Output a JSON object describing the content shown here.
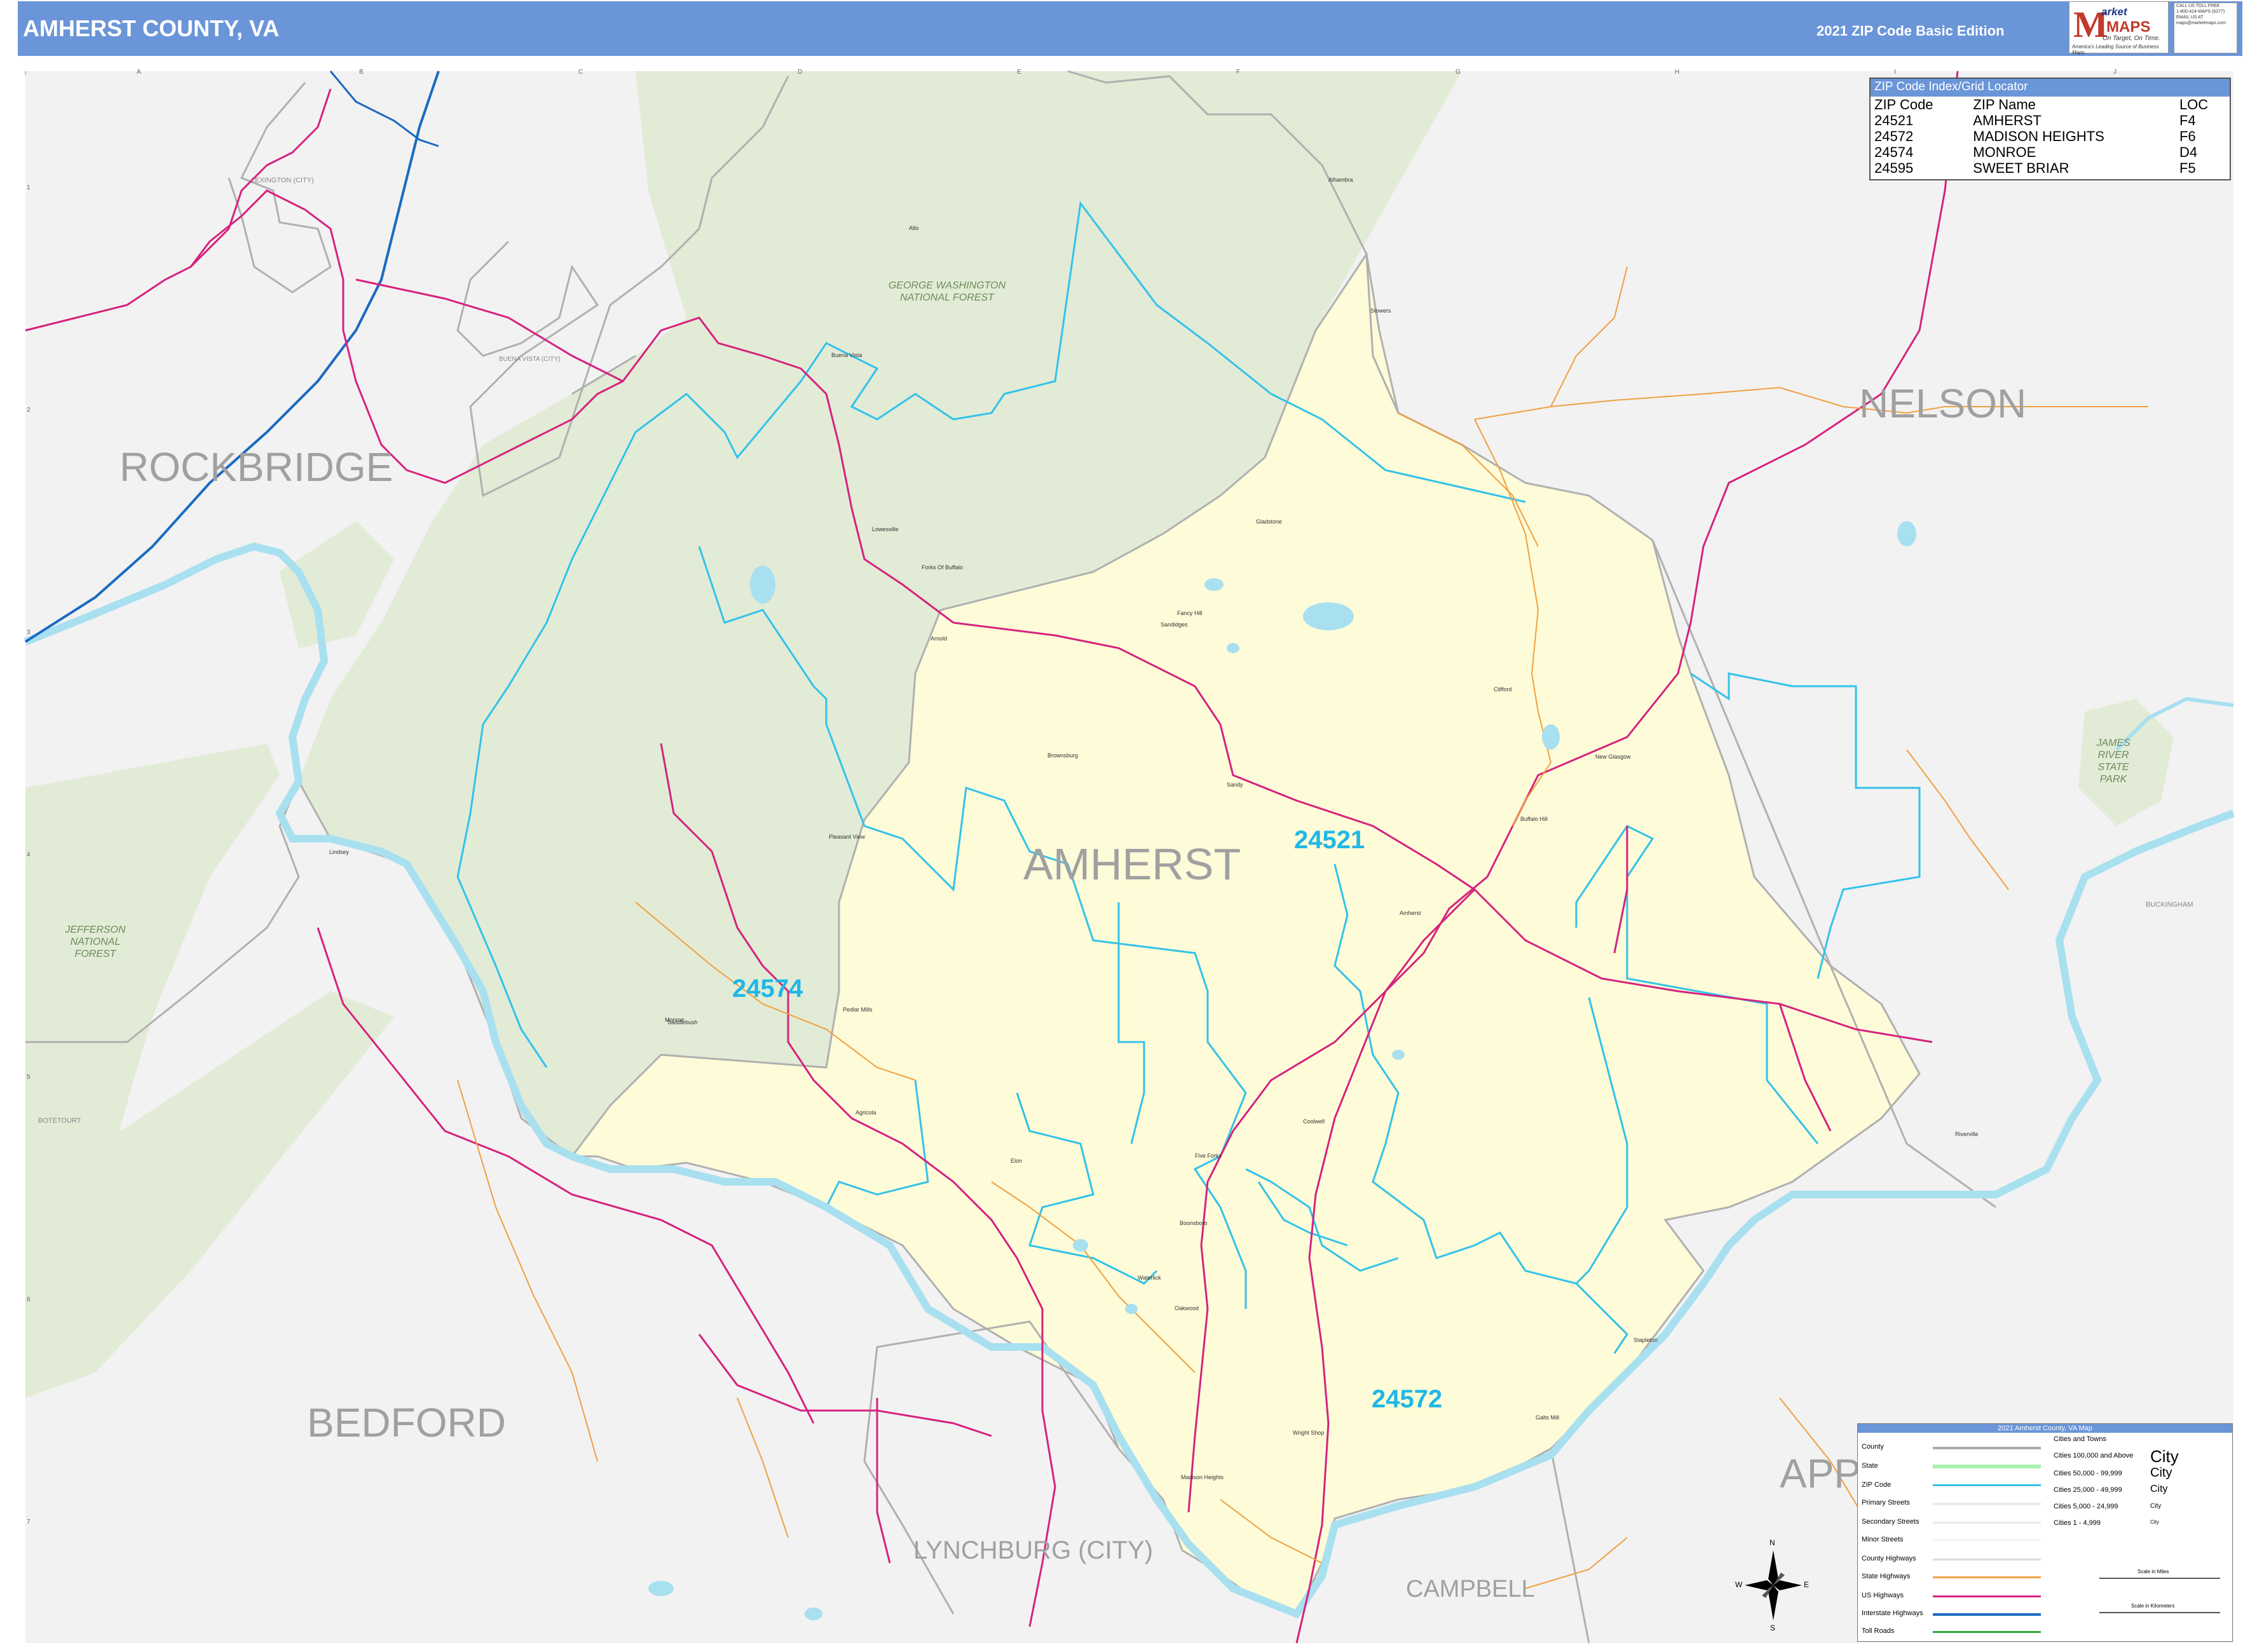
{
  "header": {
    "title": "AMHERST COUNTY, VA",
    "edition": "2021 ZIP Code Basic Edition",
    "logo_main": "MAPS",
    "logo_script": "arket",
    "logo_tagline": "On Target, On Time.",
    "logo_sub": "America's Leading Source of Business Maps",
    "contact_lines": [
      "CALL US TOLL FREE",
      "1-800-424-MAPS (6277)",
      "EMAIL US AT",
      "maps@marketmaps.com"
    ]
  },
  "grid": {
    "columns": [
      "A",
      "B",
      "C",
      "D",
      "E",
      "F",
      "G",
      "H",
      "I",
      "J"
    ],
    "rows": [
      "1",
      "2",
      "3",
      "4",
      "5",
      "6",
      "7"
    ]
  },
  "regions": {
    "main_county": "AMHERST",
    "neighbors": [
      "ROCKBRIDGE",
      "NELSON",
      "BEDFORD",
      "LYNCHBURG (CITY)",
      "CAMPBELL",
      "APP"
    ],
    "minor": [
      "BUCKINGHAM",
      "BOTETOURT",
      "LEXINGTON (CITY)",
      "BUENA VISTA (CITY)"
    ]
  },
  "parks": {
    "gw_forest": "GEORGE WASHINGTON NATIONAL FOREST",
    "jefferson": "JEFFERSON NATIONAL FOREST",
    "james_river": "JAMES RIVER STATE PARK"
  },
  "zip_labels": [
    "24574",
    "24521",
    "24572"
  ],
  "towns": [
    "Alhambra",
    "Alto",
    "Forks Of Buffalo",
    "Stowers",
    "Buena Vista",
    "Gladstone",
    "Fancy Hill",
    "Sandidges",
    "Elon",
    "Clifford",
    "Lowesville",
    "Whitmell",
    "Brownsburg",
    "Sandy",
    "New Glasgow",
    "Buffalo Hill",
    "Pleasant View",
    "Amherst",
    "Pedlar Mills",
    "Monroe",
    "Coolwell",
    "Five Forks",
    "Agricola",
    "Elon",
    "Riverville",
    "Sweet Briar",
    "Boonsboro",
    "Waterlick",
    "Oakwood",
    "Wright Shop",
    "Madison Heights",
    "Stapleton",
    "Galts Mill",
    "Lindsey",
    "Saddlebush",
    "Arnold"
  ],
  "zip_index": {
    "title": "ZIP Code Index/Grid Locator",
    "headers": [
      "ZIP Code",
      "ZIP Name",
      "LOC"
    ],
    "rows": [
      [
        "24521",
        "AMHERST",
        "F4"
      ],
      [
        "24572",
        "MADISON HEIGHTS",
        "F6"
      ],
      [
        "24574",
        "MONROE",
        "D4"
      ],
      [
        "24595",
        "SWEET BRIAR",
        "F5"
      ]
    ]
  },
  "legend": {
    "title": "2021 Amherst County, VA Map",
    "line_items": [
      "County",
      "State",
      "ZIP Code",
      "Primary Streets",
      "Secondary Streets",
      "Minor Streets",
      "County Highways",
      "State Highways",
      "US Highways",
      "Interstate Highways",
      "Toll Roads"
    ],
    "city_header": "Cities and Towns",
    "city_items": [
      "Cities 100,000 and Above",
      "Cities 50,000 - 99,999",
      "Cities 25,000 - 49,999",
      "Cities 5,000 - 24,999",
      "Cities 1 - 4,999"
    ],
    "city_word": "City",
    "scale_miles": "Scale in Miles",
    "scale_km": "Scale in Kilometers"
  },
  "compass": {
    "n": "N",
    "s": "S",
    "e": "E",
    "w": "W"
  },
  "colors": {
    "header": "#6a95d8",
    "county_fill": "#fdfbd8",
    "forest_fill": "#e2ebd6",
    "water": "#a8e0f0",
    "zip_line": "#33c2ea",
    "us_highway": "#d6227e",
    "state_highway": "#f0a040",
    "interstate": "#1a6ac2"
  }
}
